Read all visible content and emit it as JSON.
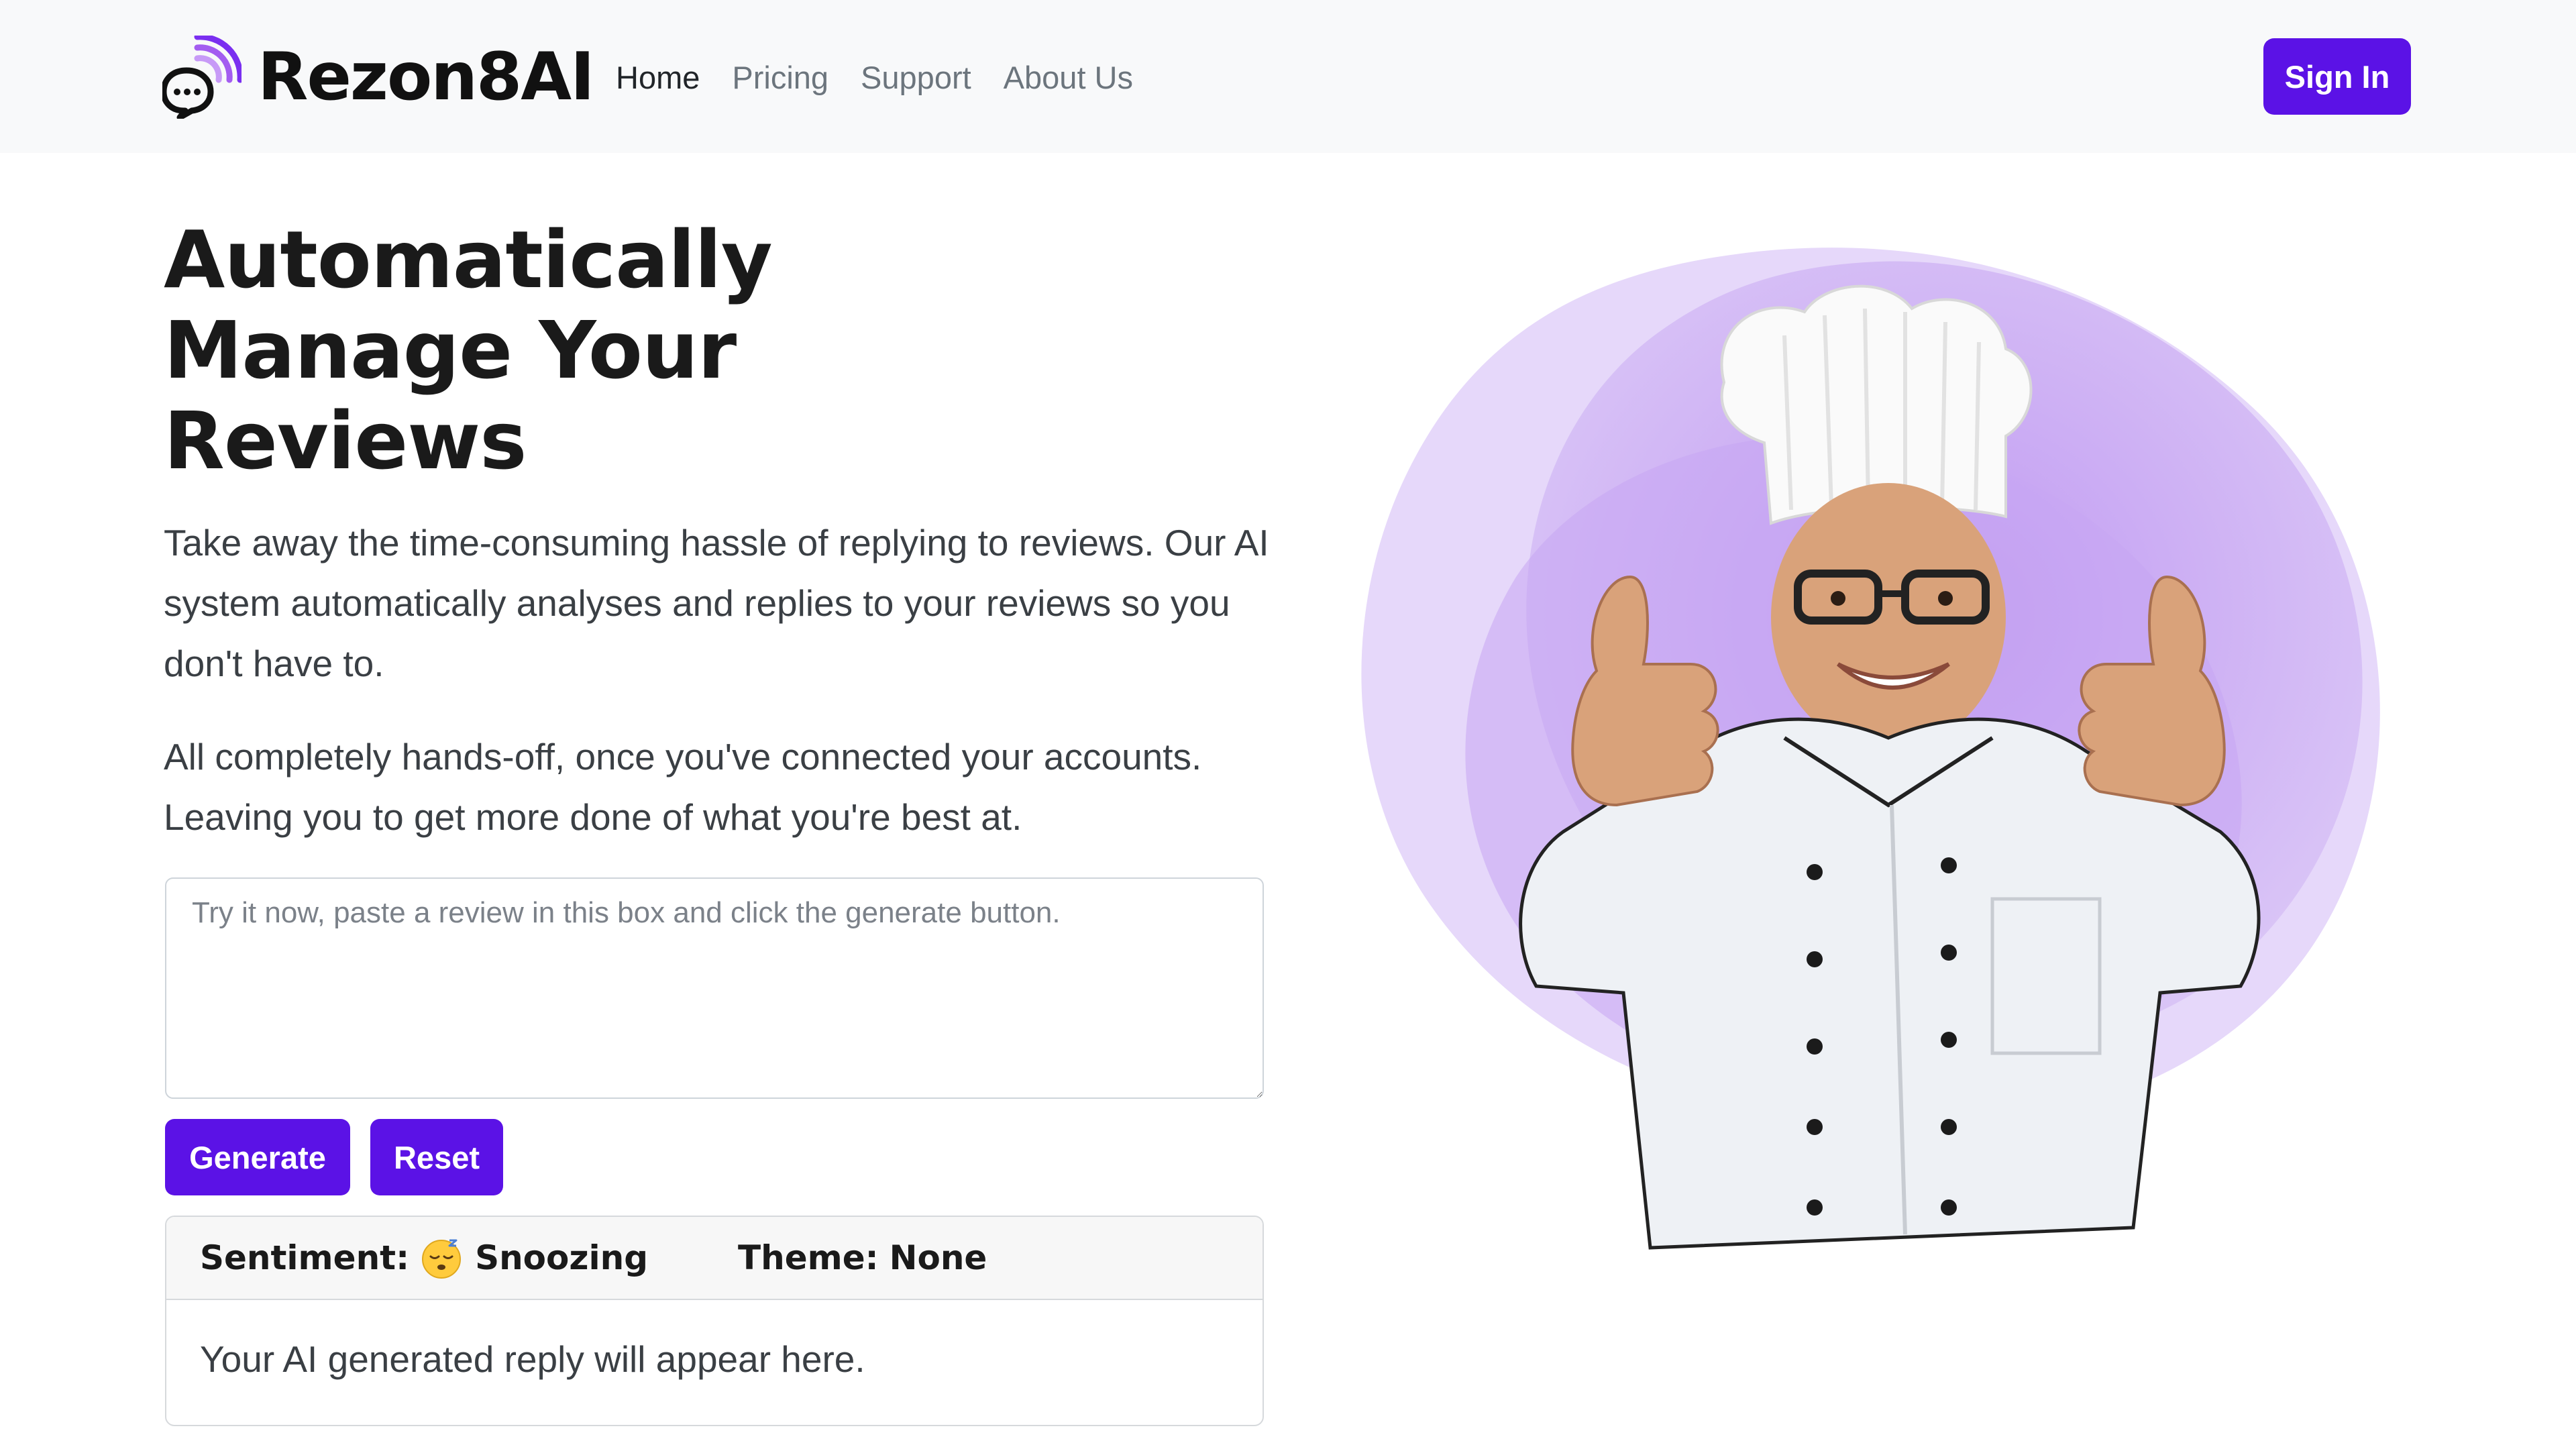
{
  "brand": {
    "name": "Rezon8AI",
    "logo_icon": "chat-bubble-signal-icon",
    "accent_color": "#5b12e6"
  },
  "nav": {
    "links": [
      {
        "label": "Home",
        "active": true
      },
      {
        "label": "Pricing",
        "active": false
      },
      {
        "label": "Support",
        "active": false
      },
      {
        "label": "About Us",
        "active": false
      }
    ],
    "sign_in_label": "Sign In"
  },
  "hero": {
    "title_lines": [
      "Automatically",
      "Manage Your",
      "Reviews"
    ],
    "paragraph_1": "Take away the time-consuming hassle of replying to reviews. Our AI system automatically analyses and replies to your reviews so you don't have to.",
    "paragraph_2": "All completely hands-off, once you've connected your accounts. Leaving you to get more done of what you're best at.",
    "image_icon": "chef-thumbs-up-illustration"
  },
  "review_box": {
    "value": "",
    "placeholder": "Try it now, paste a review in this box and click the generate button."
  },
  "actions": {
    "generate_label": "Generate",
    "reset_label": "Reset"
  },
  "result": {
    "sentiment_label": "Sentiment:",
    "sentiment_icon": "sleeping-face-emoji-icon",
    "sentiment_value": "Snoozing",
    "theme_label": "Theme:",
    "theme_value": "None",
    "reply_text": "Your AI generated reply will appear here."
  }
}
